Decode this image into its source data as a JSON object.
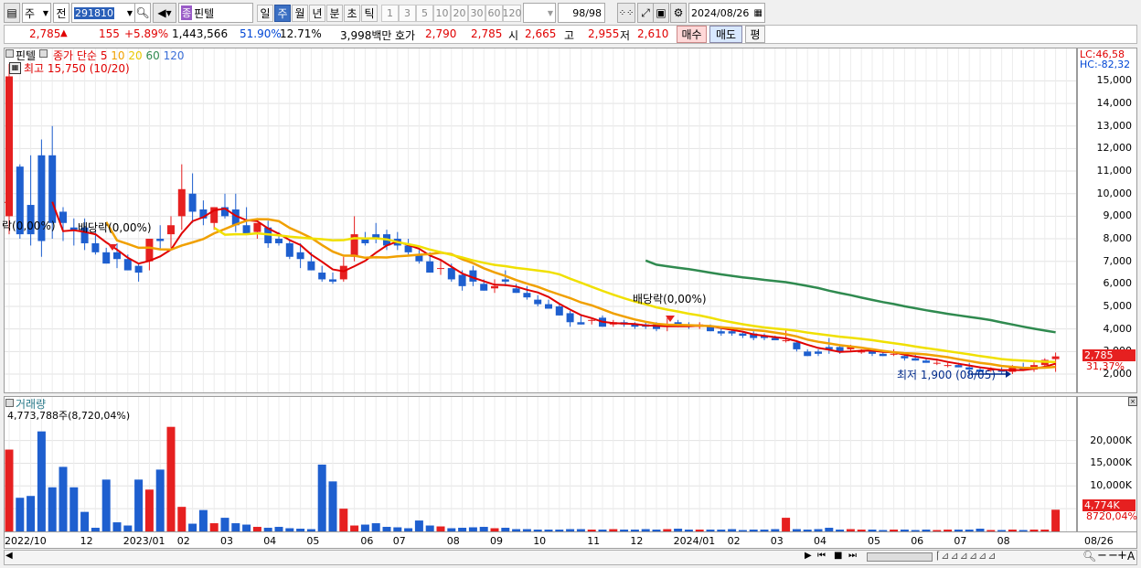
{
  "toolbar": {
    "period_main": "주",
    "period_prev": "전",
    "code": "291810",
    "name": "핀텔",
    "name_badge": "종",
    "periods": [
      "일",
      "주",
      "월",
      "년",
      "분",
      "초",
      "틱"
    ],
    "active_period": "주",
    "intervals": [
      "1",
      "3",
      "5",
      "10",
      "20",
      "30",
      "60",
      "120"
    ],
    "count": "98/98",
    "date": "2024/08/26"
  },
  "quote": {
    "price": "2,785",
    "arrow": "▲",
    "change": "155",
    "change_pct": "+5.89%",
    "volume": "1,443,566",
    "vol_ratio": "51.90%",
    "turnover": "12.71%",
    "amount": "3,998백만",
    "bid_label": "호가",
    "ask": "2,790",
    "bid": "2,785",
    "open_label": "시",
    "open": "2,665",
    "high_label": "고",
    "high": "2,955",
    "low_label": "저",
    "low": "2,610",
    "buy_label": "매수",
    "sell_label": "매도",
    "flat_label": "평"
  },
  "price_panel": {
    "stock_name": "핀텔",
    "ma_label": "종가 단순",
    "ma_periods": [
      {
        "label": "5",
        "color": "#e00000"
      },
      {
        "label": "10",
        "color": "#f0a000"
      },
      {
        "label": "20",
        "color": "#e8c800"
      },
      {
        "label": "60",
        "color": "#2f8a4f"
      },
      {
        "label": "120",
        "color": "#3a6fd8"
      }
    ],
    "high_note": "최고 15,750 (10/20)",
    "low_note": "최저 1,900 (08/05)",
    "dividend_note": "배당락(0,00%)",
    "dividend_note_left": "배당락(0,00%)",
    "left_edge_note": "락(0,00%)",
    "lc": "LC:46,58",
    "hc": "HC:-82,32",
    "y_ticks": [
      "15,000",
      "14,000",
      "13,000",
      "12,000",
      "11,000",
      "10,000",
      "9,000",
      "8,000",
      "7,000",
      "6,000",
      "5,000",
      "4,000",
      "3,000",
      "2,000"
    ],
    "current_badge": "2,785",
    "current_pct": "31,37%"
  },
  "volume_panel": {
    "title": "거래량",
    "value_note": "4,773,788주(8,720,04%)",
    "y_ticks": [
      "20,000K",
      "15,000K",
      "10,000K",
      "5,000K"
    ],
    "current_badge": "4,774K",
    "current_pct": "8720,04%"
  },
  "x_axis": {
    "labels": [
      "2022/10",
      "12",
      "2023/01",
      "02",
      "03",
      "04",
      "05",
      "06",
      "07",
      "08",
      "09",
      "10",
      "11",
      "12",
      "2024/01",
      "02",
      "03",
      "04",
      "05",
      "06",
      "07",
      "08",
      "08/26"
    ]
  },
  "chart_data": {
    "type": "candlestick",
    "title": "핀텔",
    "y_unit": "KRW",
    "ylim": [
      1500,
      16000
    ],
    "volume_ylim": [
      0,
      23000
    ],
    "weeks": 98,
    "candles": [
      [
        9000,
        15750,
        8200,
        15200
      ],
      [
        11200,
        11300,
        8000,
        8200
      ],
      [
        9500,
        11700,
        7700,
        8200
      ],
      [
        11700,
        12400,
        7200,
        7900
      ],
      [
        11700,
        13000,
        8000,
        8700
      ],
      [
        9200,
        9400,
        7900,
        8700
      ],
      [
        8500,
        8900,
        7700,
        8400
      ],
      [
        8500,
        8900,
        7500,
        7800
      ],
      [
        7800,
        8400,
        7300,
        7400
      ],
      [
        7400,
        7600,
        6900,
        6900
      ],
      [
        7400,
        7800,
        6700,
        7100
      ],
      [
        7100,
        7300,
        6600,
        6600
      ],
      [
        6800,
        6900,
        6100,
        6500
      ],
      [
        7000,
        8000,
        6600,
        8000
      ],
      [
        8000,
        8600,
        7500,
        7900
      ],
      [
        8200,
        9000,
        7600,
        8600
      ],
      [
        9000,
        11300,
        8400,
        10200
      ],
      [
        10000,
        10900,
        8700,
        9200
      ],
      [
        9300,
        9700,
        8600,
        8900
      ],
      [
        8700,
        9400,
        8400,
        9400
      ],
      [
        9400,
        10000,
        8900,
        9000
      ],
      [
        9300,
        10000,
        8300,
        8600
      ],
      [
        8600,
        9400,
        8200,
        8200
      ],
      [
        8300,
        8700,
        8000,
        8700
      ],
      [
        8500,
        8800,
        7600,
        7800
      ],
      [
        8000,
        8300,
        7700,
        7800
      ],
      [
        7800,
        7900,
        7100,
        7200
      ],
      [
        7400,
        7800,
        6700,
        7100
      ],
      [
        7000,
        7400,
        6600,
        6600
      ],
      [
        6500,
        6800,
        6100,
        6200
      ],
      [
        6200,
        6500,
        6000,
        6100
      ],
      [
        6200,
        7200,
        6100,
        6800
      ],
      [
        7200,
        9000,
        7000,
        8200
      ],
      [
        8000,
        8300,
        7700,
        7800
      ],
      [
        8200,
        8700,
        7800,
        8000
      ],
      [
        8200,
        8400,
        7500,
        7700
      ],
      [
        8000,
        8300,
        7500,
        7700
      ],
      [
        7700,
        8000,
        7300,
        7400
      ],
      [
        7300,
        7500,
        6900,
        7000
      ],
      [
        7000,
        7400,
        6500,
        6500
      ],
      [
        6700,
        7100,
        6400,
        6700
      ],
      [
        6700,
        6900,
        6100,
        6200
      ],
      [
        6400,
        6600,
        5700,
        5900
      ],
      [
        6600,
        6800,
        5900,
        6100
      ],
      [
        6000,
        6200,
        5700,
        5700
      ],
      [
        5800,
        6200,
        5600,
        5900
      ],
      [
        6200,
        6600,
        5900,
        6100
      ],
      [
        5800,
        6000,
        5600,
        5600
      ],
      [
        5600,
        5900,
        5300,
        5400
      ],
      [
        5300,
        5500,
        5000,
        5100
      ],
      [
        5100,
        5300,
        4900,
        4900
      ],
      [
        5000,
        5100,
        4600,
        4600
      ],
      [
        4700,
        4800,
        4100,
        4300
      ],
      [
        4300,
        4600,
        4200,
        4200
      ],
      [
        4400,
        4500,
        4200,
        4400
      ],
      [
        4500,
        4600,
        4100,
        4100
      ],
      [
        4200,
        4400,
        4100,
        4300
      ],
      [
        4300,
        4400,
        4100,
        4200
      ],
      [
        4200,
        4300,
        4000,
        4100
      ],
      [
        4200,
        4300,
        4000,
        4100
      ],
      [
        4200,
        4300,
        3900,
        4000
      ],
      [
        4100,
        4500,
        3900,
        4200
      ],
      [
        4300,
        4400,
        4100,
        4200
      ],
      [
        4200,
        4300,
        4000,
        4100
      ],
      [
        4100,
        4300,
        4000,
        4200
      ],
      [
        4100,
        4200,
        3900,
        3900
      ],
      [
        3900,
        4000,
        3700,
        3800
      ],
      [
        3900,
        4000,
        3700,
        3800
      ],
      [
        3800,
        3900,
        3600,
        3700
      ],
      [
        3800,
        3900,
        3500,
        3600
      ],
      [
        3700,
        3800,
        3500,
        3600
      ],
      [
        3600,
        3700,
        3500,
        3500
      ],
      [
        3500,
        4000,
        3400,
        3500
      ],
      [
        3400,
        3500,
        3000,
        3100
      ],
      [
        3000,
        3100,
        2800,
        2800
      ],
      [
        3000,
        3100,
        2800,
        2900
      ],
      [
        3200,
        3600,
        2900,
        3100
      ],
      [
        3200,
        3300,
        2900,
        3000
      ],
      [
        3100,
        3300,
        3000,
        3200
      ],
      [
        3000,
        3100,
        2900,
        3000
      ],
      [
        3000,
        3100,
        2800,
        2900
      ],
      [
        2900,
        3000,
        2800,
        2800
      ],
      [
        2900,
        3100,
        2800,
        2900
      ],
      [
        2800,
        2900,
        2600,
        2700
      ],
      [
        2700,
        2900,
        2600,
        2600
      ],
      [
        2600,
        2700,
        2500,
        2500
      ],
      [
        2500,
        2600,
        2400,
        2500
      ],
      [
        2400,
        2500,
        2300,
        2400
      ],
      [
        2400,
        2500,
        2300,
        2300
      ],
      [
        2300,
        2500,
        1900,
        2200
      ],
      [
        2200,
        2300,
        2100,
        2100
      ],
      [
        2200,
        2300,
        2100,
        2200
      ],
      [
        2200,
        2300,
        2000,
        2100
      ],
      [
        2100,
        2400,
        2000,
        2300
      ],
      [
        2300,
        2500,
        2200,
        2200
      ],
      [
        2200,
        2600,
        2100,
        2400
      ],
      [
        2400,
        2700,
        2300,
        2630
      ],
      [
        2665,
        2955,
        2100,
        2785
      ]
    ],
    "volumes_k": [
      18000,
      7400,
      7800,
      22000,
      9700,
      14200,
      9700,
      4300,
      800,
      11400,
      2000,
      1300,
      11400,
      9200,
      13600,
      23000,
      5400,
      1700,
      4700,
      1800,
      3000,
      1800,
      1500,
      1000,
      800,
      1000,
      700,
      600,
      500,
      14700,
      11000,
      5000,
      1300,
      1500,
      1800,
      1000,
      900,
      700,
      2400,
      1300,
      1100,
      700,
      800,
      900,
      1000,
      700,
      800,
      500,
      500,
      400,
      400,
      400,
      500,
      500,
      400,
      400,
      500,
      400,
      400,
      500,
      400,
      500,
      600,
      400,
      400,
      400,
      400,
      500,
      300,
      400,
      400,
      500,
      3000,
      500,
      400,
      500,
      800,
      400,
      500,
      400,
      400,
      300,
      400,
      400,
      300,
      400,
      300,
      400,
      400,
      400,
      600,
      300,
      300,
      400,
      300,
      400,
      400,
      4774
    ],
    "moving_averages": [
      {
        "period": "5",
        "color": "#e00000"
      },
      {
        "period": "10",
        "color": "#f0a000"
      },
      {
        "period": "20",
        "color": "#f0e000"
      },
      {
        "period": "60",
        "color": "#2f8a4f"
      }
    ]
  }
}
